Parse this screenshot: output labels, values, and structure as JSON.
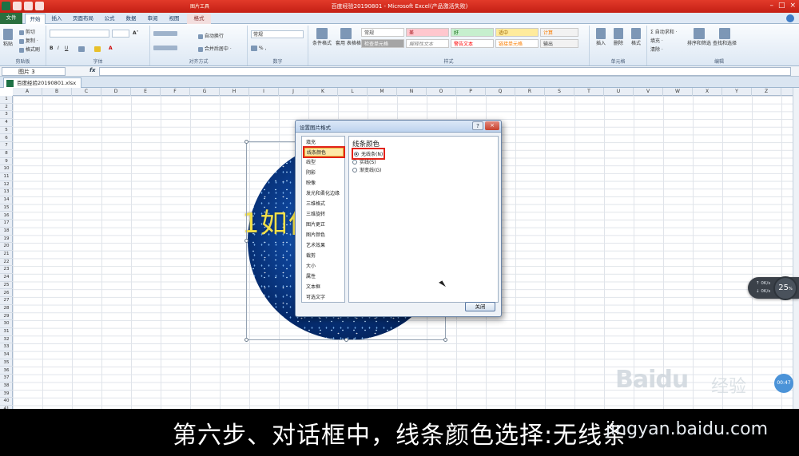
{
  "window": {
    "title": "百度经验20190801 - Microsoft Excel(产品激活失败)",
    "context_group": "图片工具",
    "controls": [
      "–",
      "□",
      "×"
    ]
  },
  "tabs": [
    {
      "label": "文件"
    },
    {
      "label": "开始"
    },
    {
      "label": "插入"
    },
    {
      "label": "页面布局"
    },
    {
      "label": "公式"
    },
    {
      "label": "数据"
    },
    {
      "label": "审阅"
    },
    {
      "label": "视图"
    },
    {
      "label": "格式"
    }
  ],
  "ribbon": {
    "clipboard": {
      "label": "剪贴板",
      "paste": "粘贴",
      "cut": "剪切",
      "copy": "复制 ·",
      "format_painter": "格式刷"
    },
    "font": {
      "label": "字体"
    },
    "alignment": {
      "label": "对齐方式",
      "wrap": "自动换行",
      "merge": "合并后居中 ·"
    },
    "number": {
      "label": "数字",
      "format": "常规"
    },
    "styles": {
      "label": "样式",
      "cond_format": "条件格式",
      "table_format": "套用\n表格格式",
      "cells": [
        "常规",
        "差",
        "好",
        "适中",
        "计算",
        "检查单元格",
        "解释性文本",
        "警告文本",
        "链接单元格",
        "输出"
      ]
    },
    "cells_group": {
      "label": "单元格",
      "insert": "插入",
      "delete": "删除",
      "format": "格式"
    },
    "editing": {
      "label": "编辑",
      "autosum": "Σ 自动求和 ·",
      "fill": "填充 ·",
      "clear": "清除 ·",
      "sort": "排序和筛选",
      "find": "查找和选择"
    }
  },
  "formula_bar": {
    "name_box": "图片 3",
    "fx": "fx"
  },
  "workbook_tab": "百度经验20190801.xlsx",
  "columns": [
    "A",
    "B",
    "C",
    "D",
    "E",
    "F",
    "G",
    "H",
    "I",
    "J",
    "K",
    "L",
    "M",
    "N",
    "O",
    "P",
    "Q",
    "R",
    "S",
    "T",
    "U",
    "V",
    "W",
    "X",
    "Y",
    "Z"
  ],
  "rows": [
    "1",
    "2",
    "3",
    "4",
    "5",
    "6",
    "7",
    "8",
    "9",
    "10",
    "11",
    "12",
    "13",
    "14",
    "15",
    "16",
    "17",
    "18",
    "19",
    "20",
    "21",
    "22",
    "23",
    "24",
    "25",
    "26",
    "27",
    "28",
    "29",
    "30",
    "31",
    "32",
    "33",
    "34",
    "35",
    "36",
    "37",
    "38",
    "39",
    "40",
    "41"
  ],
  "picture_text": "1如何",
  "dialog": {
    "title": "设置图片格式",
    "help": "?",
    "close": "×",
    "nav": [
      "填充",
      "线条颜色",
      "线型",
      "阴影",
      "映像",
      "发光和柔化边缘",
      "三维格式",
      "三维旋转",
      "图片更正",
      "图片颜色",
      "艺术效果",
      "裁剪",
      "大小",
      "属性",
      "文本框",
      "可选文字"
    ],
    "selected_nav": "线条颜色",
    "panel_title": "线条颜色",
    "options": [
      {
        "label": "无线条(N)",
        "selected": true
      },
      {
        "label": "实线(S)",
        "selected": false
      },
      {
        "label": "渐变线(G)",
        "selected": false
      }
    ],
    "close_button": "关闭"
  },
  "overlay": {
    "net_up": "0K/s",
    "net_down": "0K/s",
    "percent": "25",
    "timer": "00:47",
    "watermark": "Baidu",
    "watermark_cn": "经验",
    "url": "jingyan.baidu.com"
  },
  "subtitle": "第六步、对话框中，线条颜色选择:无线条"
}
